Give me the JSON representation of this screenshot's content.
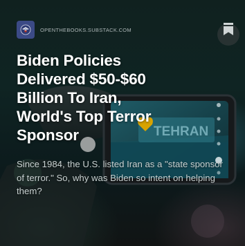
{
  "publication": {
    "name": "OPENTHEBOOKS.SUBSTACK.COM",
    "logo_icon": "eagle-seal-icon",
    "logo_color": "#3b4a86"
  },
  "actions": {
    "bookmark_icon": "bookmark-icon"
  },
  "article": {
    "title_lines": [
      "Biden Policies",
      "Delivered $50-$60",
      "Billion To Iran,",
      "World's Top Terror",
      "Sponsor"
    ],
    "subtitle": "Since 1984, the U.S. listed Iran as a \"state sponsor of terror.\" So, why was Biden so intent on helping them?"
  },
  "hero_image": {
    "sign_text": "TEHRAN",
    "accent_color": "#d8a300"
  }
}
